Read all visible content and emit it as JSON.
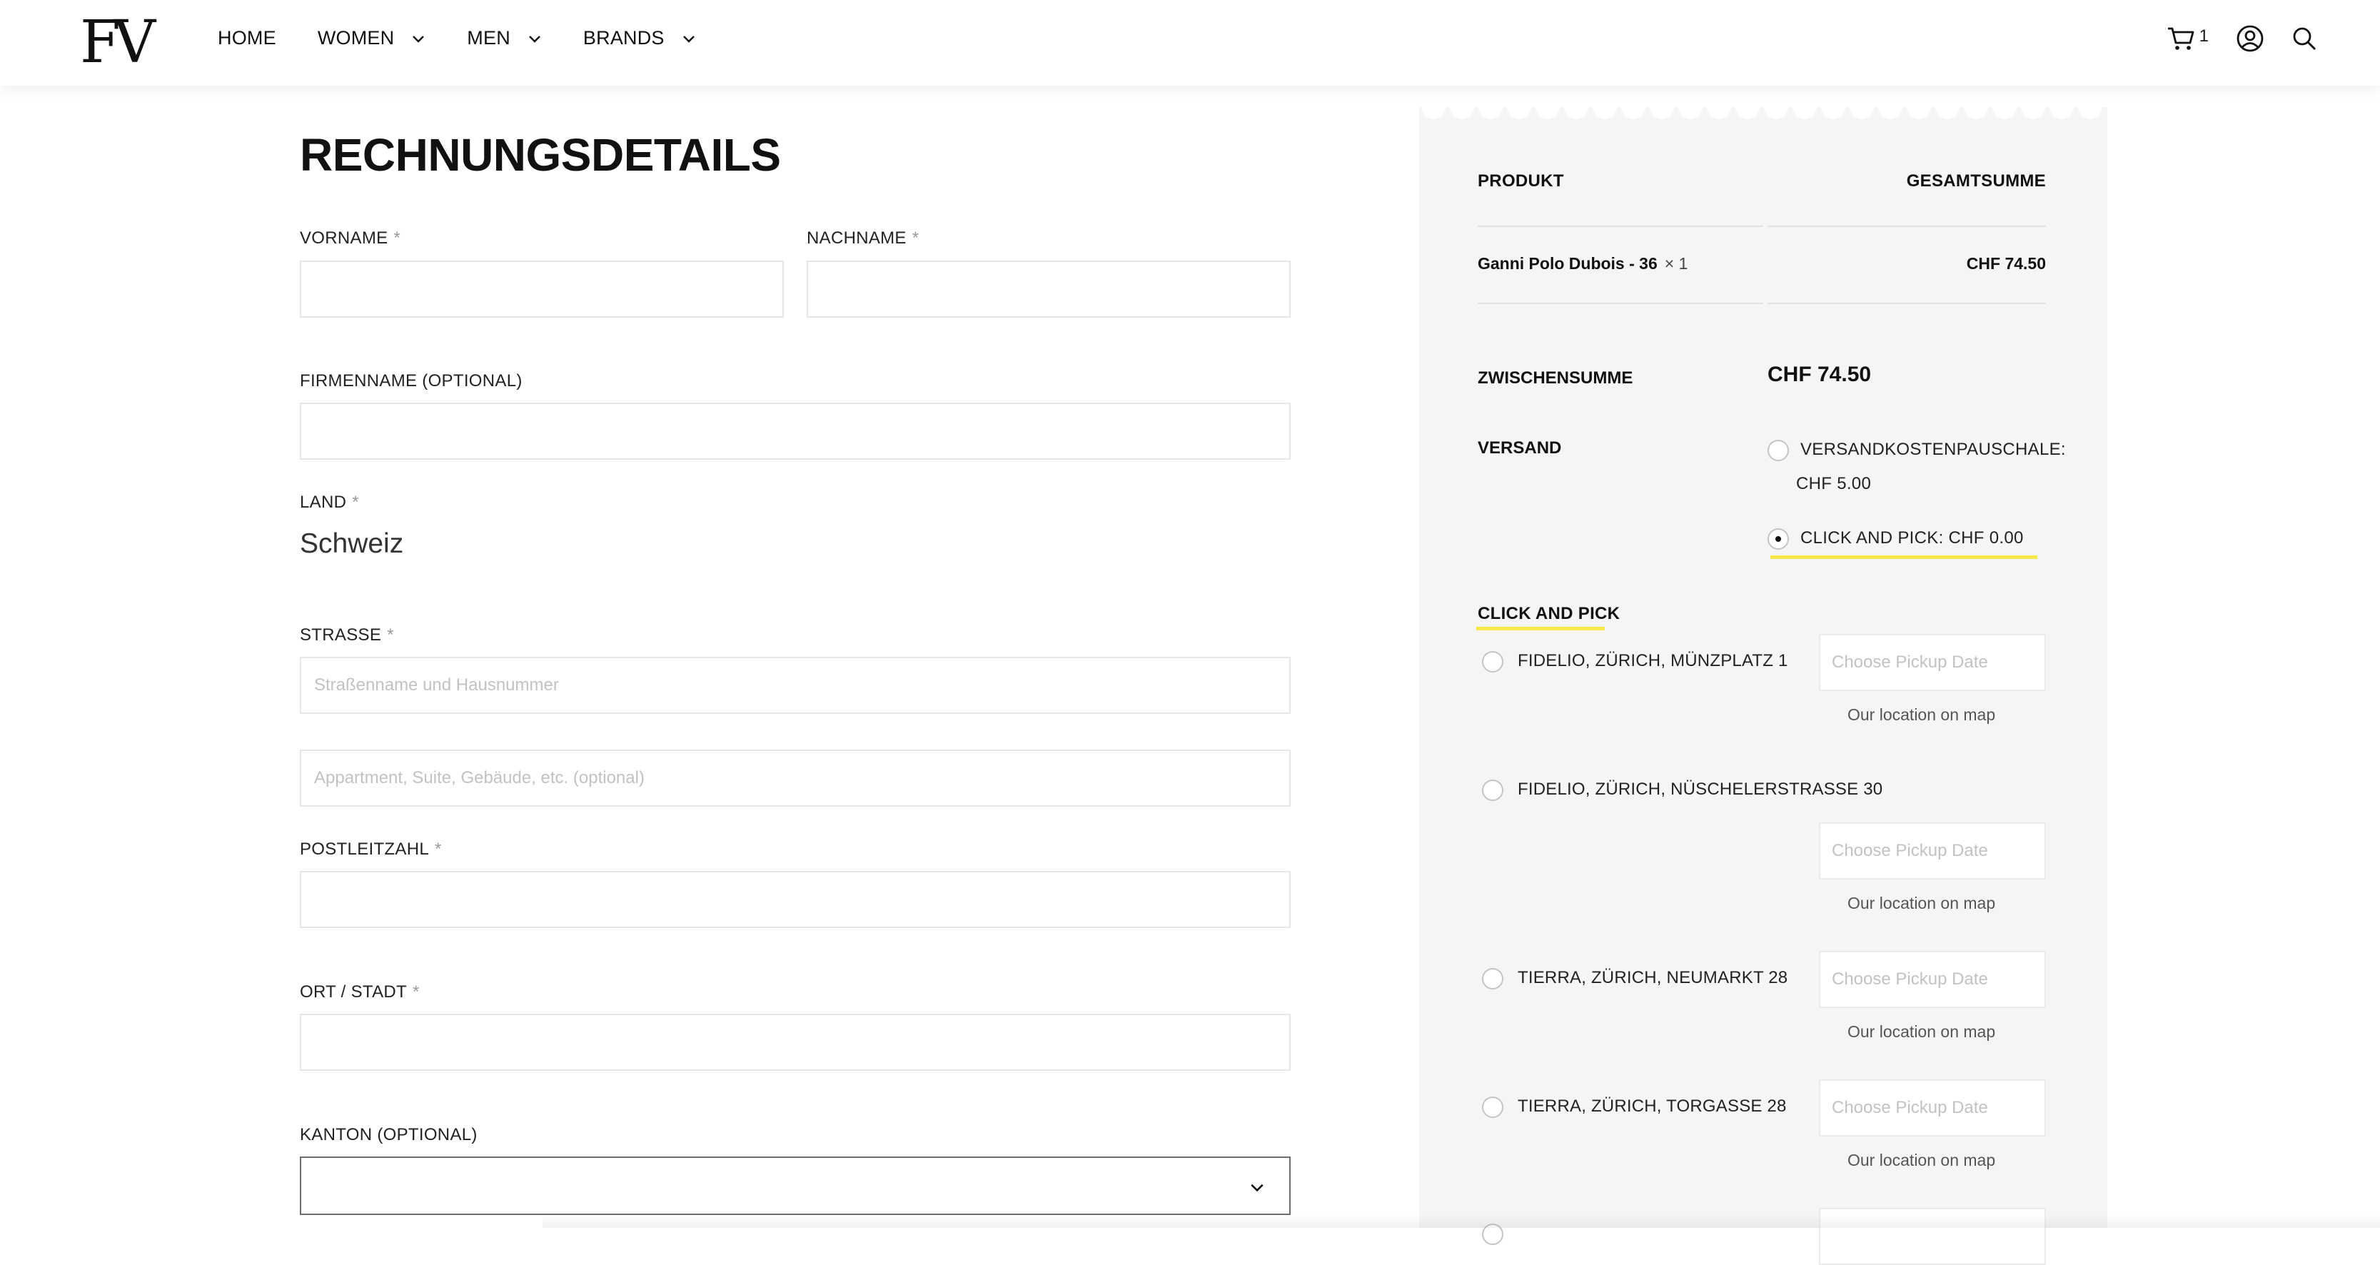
{
  "header": {
    "logo_text": "FV",
    "nav": [
      {
        "label": "HOME"
      },
      {
        "label": "WOMEN"
      },
      {
        "label": "MEN"
      },
      {
        "label": "BRANDS"
      }
    ],
    "cart_count": "1"
  },
  "form": {
    "title": "RECHNUNGSDETAILS",
    "required_mark": "*",
    "first_name_label": "VORNAME",
    "last_name_label": "NACHNAME",
    "company_label": "FIRMENNAME (OPTIONAL)",
    "country_label": "LAND",
    "country_value": "Schweiz",
    "street_label": "STRASSE",
    "street_placeholder": "Straßenname und Hausnummer",
    "street2_placeholder": "Appartment, Suite, Gebäude, etc. (optional)",
    "zip_label": "POSTLEITZAHL",
    "city_label": "ORT / STADT",
    "canton_label": "KANTON (OPTIONAL)"
  },
  "summary": {
    "col_product": "PRODUKT",
    "col_total": "GESAMTSUMME",
    "item_name": "Ganni Polo Dubois - 36",
    "item_qty": "× 1",
    "item_price": "CHF 74.50",
    "subtotal_label": "ZWISCHENSUMME",
    "subtotal_value": "CHF 74.50",
    "shipping_label": "VERSAND",
    "shipping_options": [
      {
        "line1": "VERSANDKOSTENPAUSCHALE:",
        "line2": "CHF 5.00",
        "selected": false
      },
      {
        "line1": "CLICK AND PICK: CHF 0.00",
        "selected": true
      }
    ],
    "click_pick_title": "CLICK AND PICK",
    "date_placeholder": "Choose Pickup Date",
    "map_link_label": "Our location on map",
    "locations": [
      {
        "name": "FIDELIO, ZÜRICH, MÜNZPLATZ 1"
      },
      {
        "name": "FIDELIO, ZÜRICH, NÜSCHELERSTRASSE 30"
      },
      {
        "name": "TIERRA, ZÜRICH, NEUMARKT 28"
      },
      {
        "name": "TIERRA, ZÜRICH, TORGASSE 28"
      }
    ]
  },
  "colors": {
    "accent_yellow": "#f7e94a",
    "summary_bg": "#f5f5f5"
  }
}
